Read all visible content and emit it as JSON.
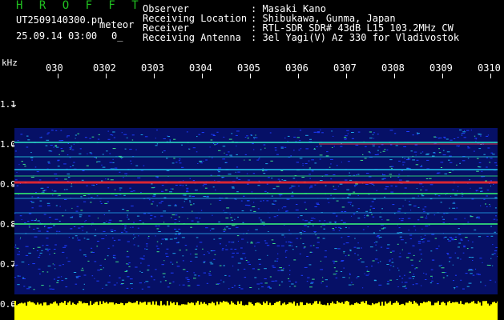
{
  "header": {
    "title": "H R O F F T",
    "filename": "UT2509140300.pn",
    "meteor_label": "meteor",
    "datetime": "25.09.14 03:00",
    "count": "0_"
  },
  "info": [
    {
      "label": "Observer",
      "value": ": Masaki Kano"
    },
    {
      "label": "Receiving Location",
      "value": ": Shibukawa, Gunma, Japan"
    },
    {
      "label": "Receiver",
      "value": ": RTL-SDR SDR# 43dB L15 103.2MHz CW"
    },
    {
      "label": "Receiving Antenna",
      "value": ": 3el Yagi(V) Az 330 for Vladivostok"
    }
  ],
  "axis": {
    "unit": "kHz",
    "y_labels": [
      "1.1",
      "1.0",
      "0.9",
      "0.8",
      "0.7",
      "0.6"
    ],
    "time_labels": [
      "030",
      "0302",
      "0303",
      "0304",
      "0305",
      "0306",
      "0307",
      "0308",
      "0309",
      "0310"
    ]
  },
  "colors": {
    "background": "#000000",
    "noise_floor": "#0a1a8a",
    "bright_echo": "#ff2a2a",
    "meteor_echo": "#30e070",
    "bottom_band": "#ffff00",
    "title_green": "#20c020"
  }
}
